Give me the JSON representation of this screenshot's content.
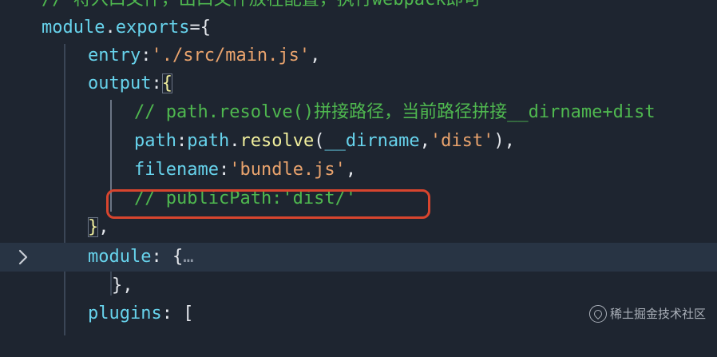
{
  "editor": {
    "lines": [
      {
        "comment": "// 将入口文件，出口文件放在配置，执行webpack即可"
      },
      {
        "obj": "module",
        "dot": ".",
        "prop": "exports",
        "eq": "=",
        "brace": "{"
      },
      {
        "key": "entry",
        "colon": ":",
        "value": "'./src/main.js'",
        "comma": ","
      },
      {
        "key": "output",
        "colon": ":",
        "brace": "{"
      },
      {
        "comment": "// path.resolve()拼接路径，当前路径拼接__dirname+dist"
      },
      {
        "key": "path",
        "colon": ":",
        "obj": "path",
        "dot": ".",
        "fn": "resolve",
        "open": "(",
        "arg1": "__dirname",
        "sep": ",",
        "arg2": "'dist'",
        "close": ")",
        "comma": ","
      },
      {
        "key": "filename",
        "colon": ":",
        "value": "'bundle.js'",
        "comma": ","
      },
      {
        "comment": "// publicPath:'dist/'"
      },
      {
        "close": "}",
        "comma": ","
      },
      {
        "key": "module",
        "colon": ":",
        "brace": "{",
        "ellipsis": "…"
      },
      {
        "close": "}",
        "comma": ","
      },
      {
        "key": "plugins",
        "colon": ":",
        "bracket": "["
      }
    ]
  },
  "watermark": {
    "text": "稀土掘金技术社区"
  },
  "colors": {
    "background": "#1e2530",
    "variable": "#67d3ec",
    "string": "#e9a36d",
    "function": "#f1ef9d",
    "comment": "#4fb84f",
    "highlight_box": "#d8452e"
  }
}
